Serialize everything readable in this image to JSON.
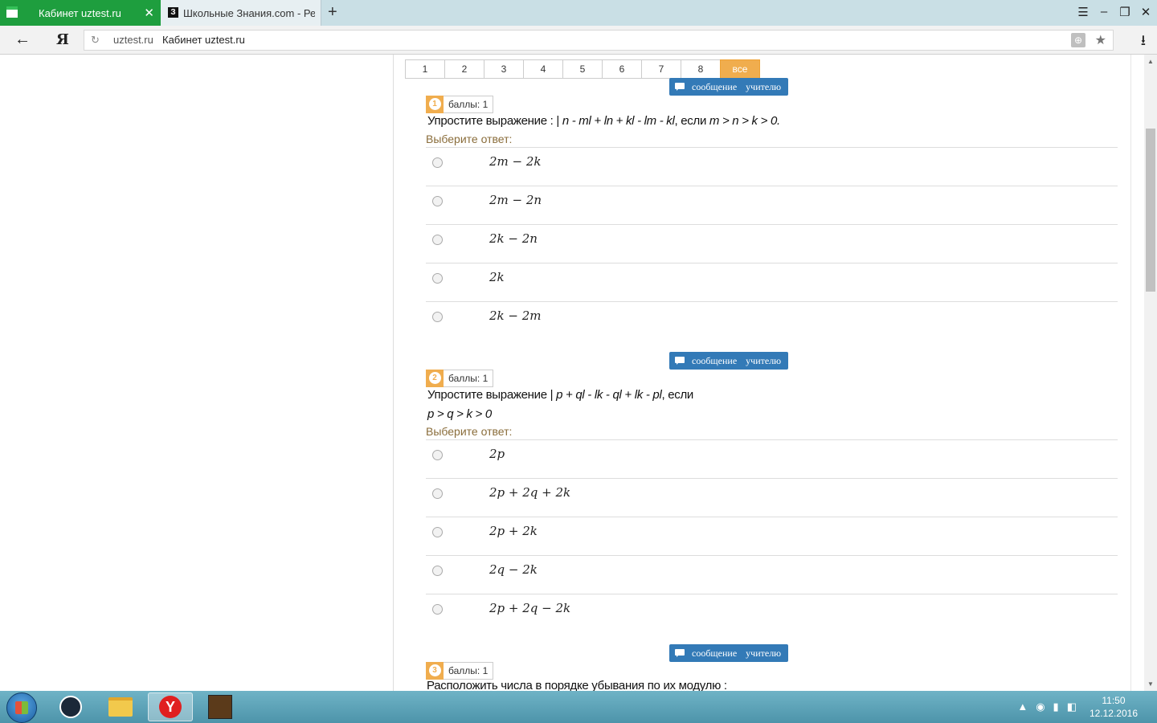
{
  "browser": {
    "tabs": [
      {
        "label": "Кабинет uztest.ru",
        "active": true
      },
      {
        "label": "Школьные Знания.com - Ре",
        "active": false
      }
    ],
    "new_tab": "+",
    "url_host": "uztest.ru",
    "page_title": "Кабинет uztest.ru"
  },
  "pagination": [
    "1",
    "2",
    "3",
    "4",
    "5",
    "6",
    "7",
    "8",
    "все"
  ],
  "message_button": "сообщение учителю",
  "choose_label": "Выберите ответ:",
  "questions": [
    {
      "number": "1",
      "score": "баллы: 1",
      "text_prefix": "Упростите выражение : | ",
      "text_expr": "n - ml + ln + kl - lm - kl",
      "text_mid": ", если ",
      "text_cond": "m > n > k > 0.",
      "answers": [
        "2m − 2k",
        "2m − 2n",
        "2k − 2n",
        "2k",
        "2k − 2m"
      ]
    },
    {
      "number": "2",
      "score": "баллы: 1",
      "text_prefix": "Упростите выражение | ",
      "text_expr": "p + ql - lk - ql + lk - pl",
      "text_mid": ", если",
      "text_cond": "p > q > k > 0",
      "answers": [
        "2p",
        "2p + 2q + 2k",
        "2p + 2k",
        "2q − 2k",
        "2p + 2q − 2k"
      ]
    },
    {
      "number": "3",
      "score": "баллы: 1",
      "text": "Расположить числа в порядке убывания по их модулю :"
    }
  ],
  "taskbar": {
    "yandex_letter": "Y",
    "time": "11:50",
    "date": "12.12.2016"
  }
}
